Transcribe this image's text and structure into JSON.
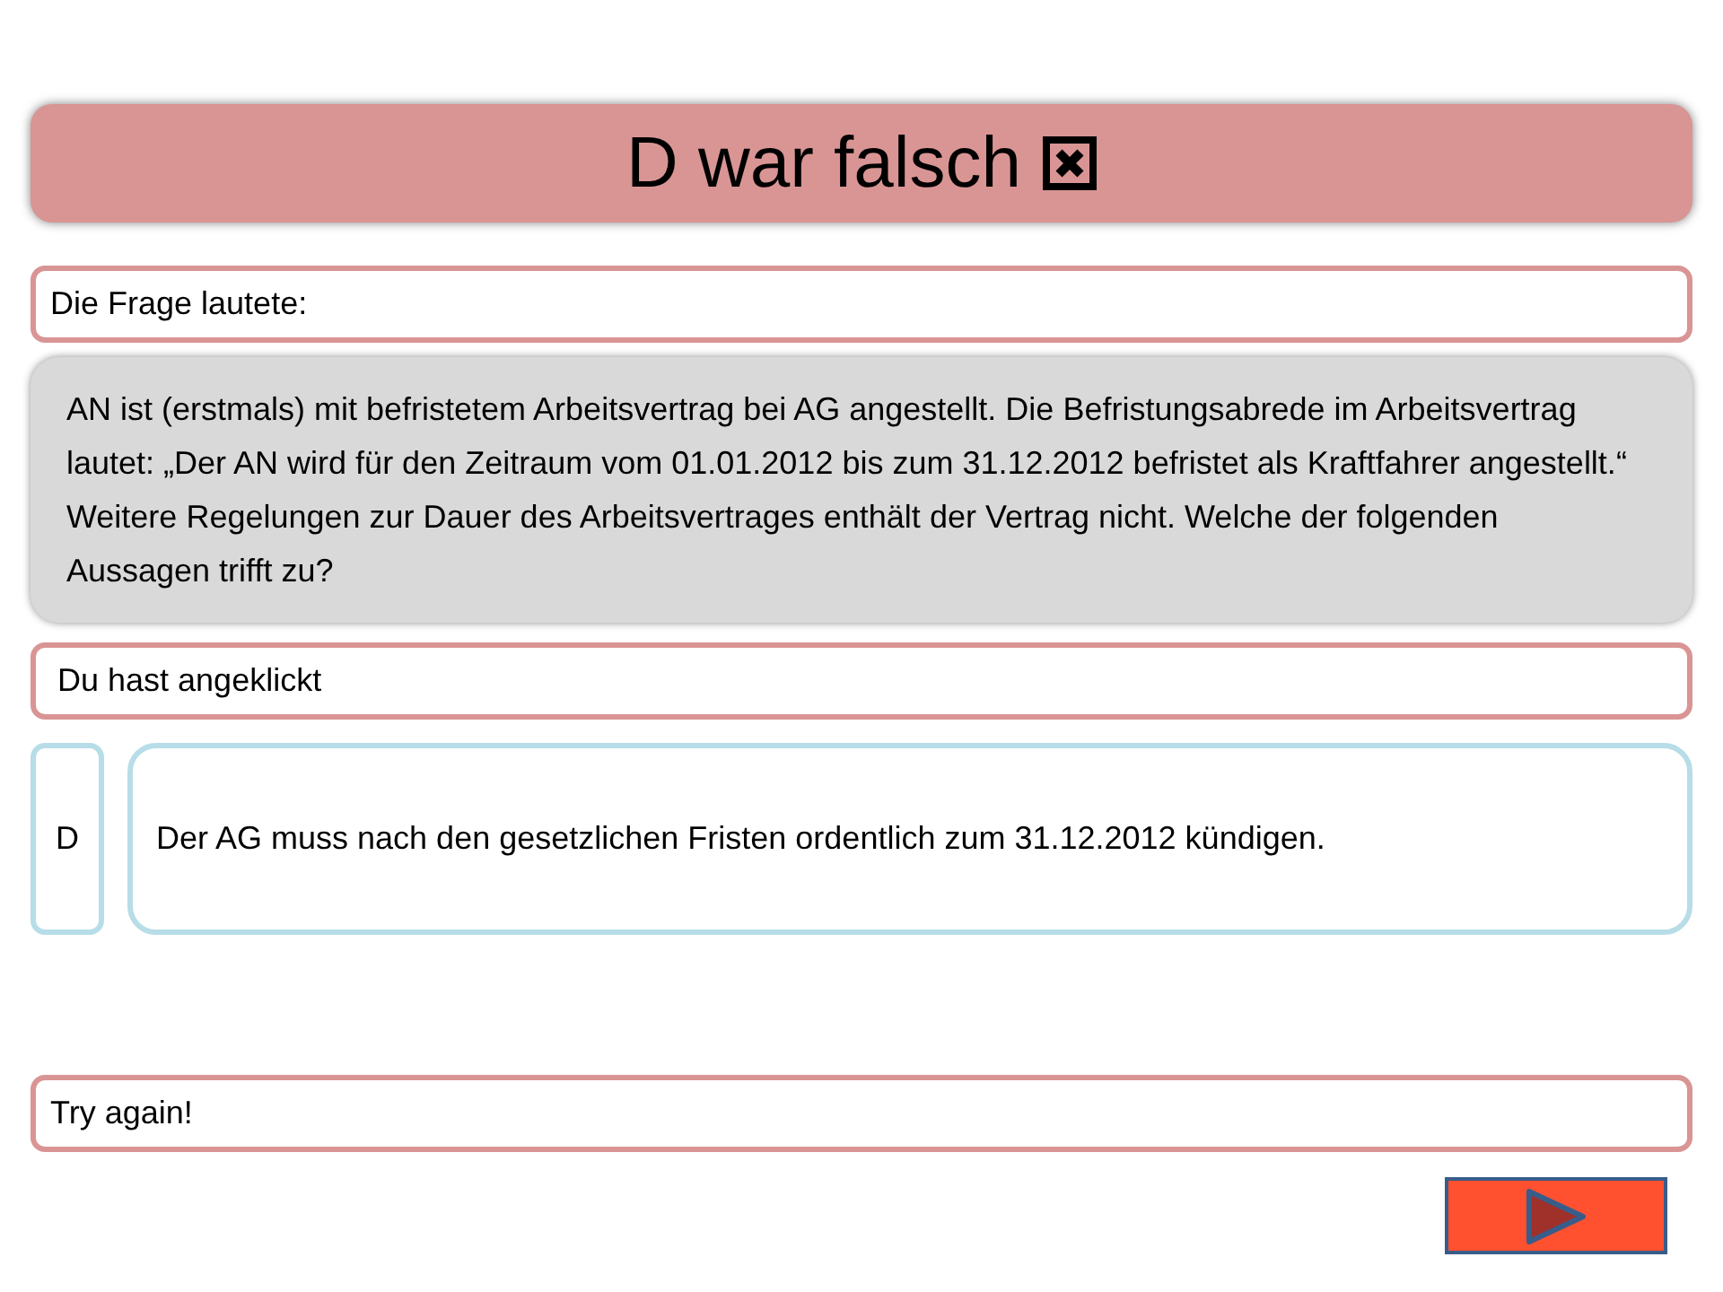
{
  "result": {
    "title": "D war falsch"
  },
  "question_label": "Die Frage lautete:",
  "question": "AN ist (erstmals) mit befristetem Arbeitsvertrag bei AG angestellt. Die Befristungsabrede im Arbeitsvertrag lautet: „Der AN wird für den Zeitraum vom 01.01.2012 bis zum 31.12.2012 befristet als Kraftfahrer angestellt.“ Weitere Regelungen zur Dauer des Arbeitsvertrages enthält der Vertrag nicht. Welche der folgenden Aussagen trifft zu?",
  "clicked_label": "Du hast angeklickt",
  "answer": {
    "letter": "D",
    "text": "Der AG muss nach den gesetzlichen Fristen ordentlich zum 31.12.2012 kündigen."
  },
  "feedback": "Try again!"
}
